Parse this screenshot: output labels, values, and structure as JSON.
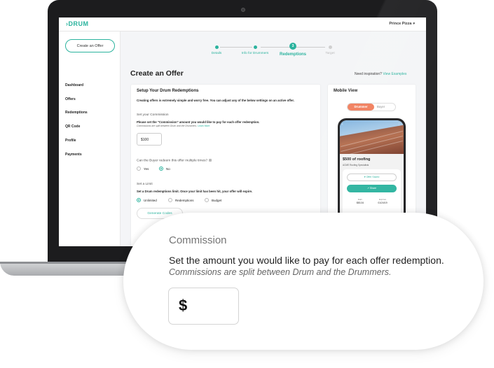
{
  "app": {
    "logo": "DRUM",
    "logo_prefix": "›"
  },
  "topbar": {
    "user": "Prince Pizza",
    "caret": "▾"
  },
  "sidebar": {
    "create_label": "Create an Offer",
    "items": [
      {
        "label": "Dashboard"
      },
      {
        "label": "Offers"
      },
      {
        "label": "Redemptions"
      },
      {
        "label": "QR Code"
      },
      {
        "label": "Profile"
      },
      {
        "label": "Payments"
      }
    ]
  },
  "stepper": {
    "steps": [
      {
        "label": "Details",
        "state": "done"
      },
      {
        "label": "Info for Drummers",
        "state": "done"
      },
      {
        "label": "Redemptions",
        "state": "current",
        "number": "3"
      },
      {
        "label": "Target",
        "state": "upcoming"
      }
    ]
  },
  "page": {
    "title": "Create an Offer",
    "inspiration_prefix": "Need inspiration?",
    "inspiration_link": "View Examples"
  },
  "setup": {
    "heading": "Setup Your Drum Redemptions",
    "intro": "Creating offers is extremely simple and worry free. You can adjust any of the below settings on an active offer.",
    "commission_title": "Set your Commission",
    "commission_desc": "Please set the \"Commission\" amount you would like to pay for each offer redemption.",
    "commission_note": "Commissions are split between Drum and the Drummers.",
    "learn_more": "Learn More",
    "commission_value": "$100",
    "multi_question": "Can the Buyer redeem this offer multiple times?",
    "multi_options": [
      {
        "label": "Yes",
        "selected": false
      },
      {
        "label": "No",
        "selected": true
      }
    ],
    "limit_title": "Set a Limit",
    "limit_desc": "Set a Drum redemptions limit. Once your limit has been hit, your offer will expire.",
    "limit_options": [
      {
        "label": "Unlimited",
        "selected": true
      },
      {
        "label": "Redemptions",
        "selected": false
      },
      {
        "label": "Budget",
        "selected": false
      }
    ],
    "generate_label": "Generate Codes"
  },
  "mobile": {
    "heading": "Mobile View",
    "toggle_on": "Drummer",
    "toggle_off": "Buyer",
    "back_icon": "‹",
    "more_icon": "⋮",
    "offer_title": "$500 of roofing",
    "offer_sub": "ACME Roofing Specialists",
    "saved_label": "♥  Offer Saved",
    "share_label": "↗  Share",
    "stats": [
      {
        "label": "Earn",
        "value": "$83.34"
      },
      {
        "label": "Expires",
        "value": "01/24/19"
      }
    ]
  },
  "zoom": {
    "label": "Commission",
    "description": "Set the amount you would like to pay for each offer redemption.",
    "note": "Commissions are split between Drum and the Drummers.",
    "currency": "$"
  },
  "colors": {
    "accent": "#2bb39e",
    "toggle": "#f07d5b",
    "bezel": "#1c1c1e"
  }
}
